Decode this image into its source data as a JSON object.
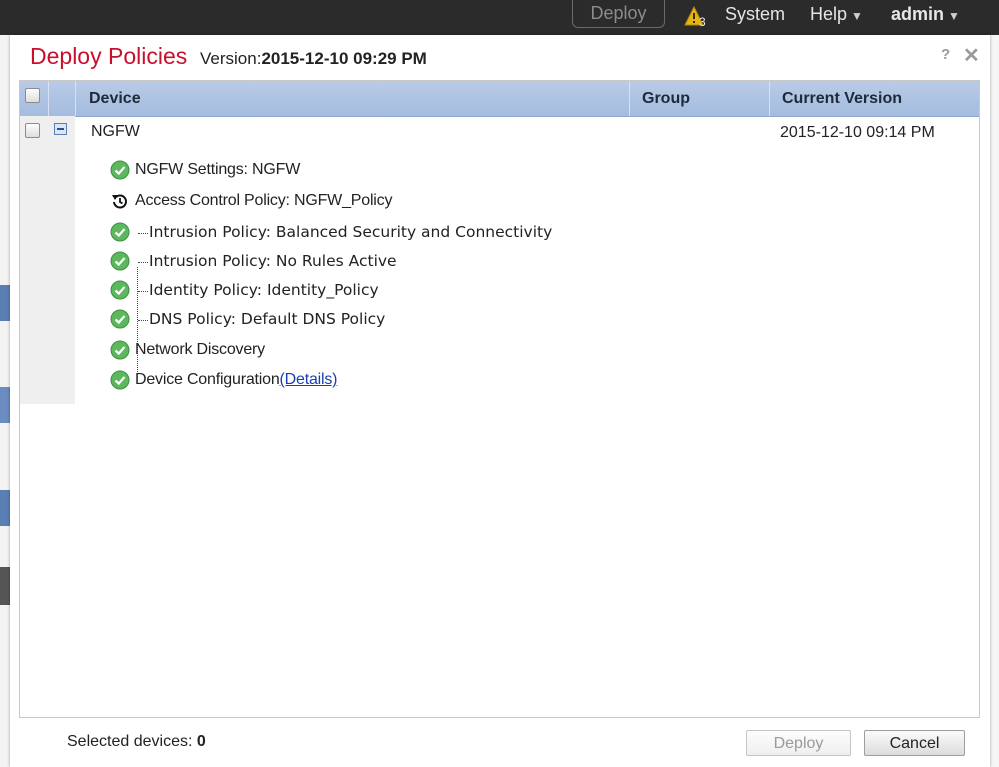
{
  "topbar": {
    "deploy_label": "Deploy",
    "alert_count": "3",
    "system_label": "System",
    "help_label": "Help",
    "user_label": "admin"
  },
  "dialog": {
    "title": "Deploy Policies",
    "version_label": "Version:",
    "version_value": "2015-12-10 09:29 PM",
    "help_symbol": "?",
    "close_symbol": "✕"
  },
  "table": {
    "columns": [
      "Device",
      "Group",
      "Current Version"
    ],
    "device": {
      "name": "NGFW",
      "current_version": "2015-12-10 09:14 PM",
      "items": [
        {
          "label": "NGFW Settings: NGFW",
          "status": "success"
        },
        {
          "label": "Access Control Policy: NGFW_Policy",
          "status": "pending"
        },
        {
          "label": "Intrusion Policy: Balanced Security and Connectivity",
          "status": "success"
        },
        {
          "label": "Intrusion Policy: No Rules Active",
          "status": "success"
        },
        {
          "label": "Identity Policy: Identity_Policy",
          "status": "success"
        },
        {
          "label": "DNS Policy: Default DNS Policy",
          "status": "success"
        },
        {
          "label": "Network Discovery",
          "status": "success"
        },
        {
          "label": "Device Configuration",
          "status": "success"
        }
      ],
      "details_link": "(Details)"
    }
  },
  "footer": {
    "selected_label": "Selected devices: ",
    "selected_count": "0",
    "deploy_label": "Deploy",
    "cancel_label": "Cancel"
  },
  "colors": {
    "title_red": "#c8102e",
    "header_blue": "#a4bcdf",
    "success_green": "#4caf50",
    "topbar": "#2b2b2b"
  },
  "icons": {
    "success": "check-circle-icon",
    "pending": "history-icon",
    "alert": "warning-triangle-icon"
  }
}
